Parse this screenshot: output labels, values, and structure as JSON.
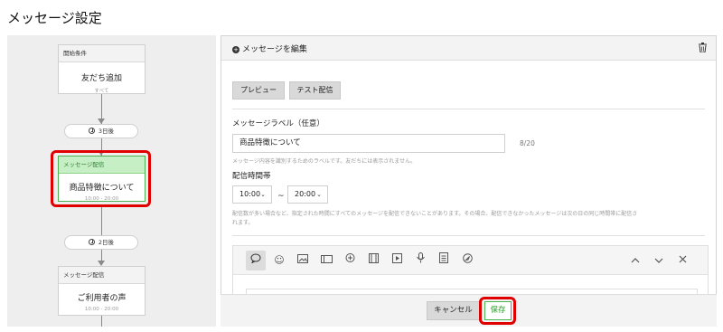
{
  "page": {
    "title": "メッセージ設定"
  },
  "flow": {
    "start_card": {
      "header": "開始条件",
      "title": "友だち追加",
      "subtitle": "すべて"
    },
    "delay1": {
      "label": "3日後"
    },
    "active_card": {
      "header": "メッセージ配信",
      "title": "商品特徴について",
      "subtitle": "10:00 - 20:00"
    },
    "delay2": {
      "label": "2日後"
    },
    "next_card": {
      "header": "メッセージ配信",
      "title": "ご利用者の声",
      "subtitle": "10:00 - 20:00"
    }
  },
  "editor": {
    "header_title": "メッセージを編集",
    "preview_button": "プレビュー",
    "test_button": "テスト配信",
    "label_field": {
      "label": "メッセージラベル（任意）",
      "value": "商品特徴について",
      "counter": "8/20",
      "help": "メッセージ内容を識別するためのラベルです。友だちには表示されません。"
    },
    "time_window": {
      "label": "配信時間帯",
      "start": "10:00",
      "separator": "~",
      "end": "20:00",
      "help_line1": "配信数が多い場合など、指定された時間にすべてのメッセージを配信できないことがあります。その場合、配信できなかったメッセージは次の日の同じ時間帯に配信さ",
      "help_line2": "れます。"
    },
    "toolbar_icons": [
      "text-bubble-icon",
      "emoji-icon",
      "image-icon",
      "card-icon",
      "coupon-icon",
      "video-icon",
      "play-icon",
      "microphone-icon",
      "rich-message-icon",
      "survey-icon"
    ]
  },
  "footer": {
    "cancel": "キャンセル",
    "save": "保存"
  },
  "colors": {
    "accent_green": "#4caf50",
    "highlight_red": "#e00000"
  }
}
